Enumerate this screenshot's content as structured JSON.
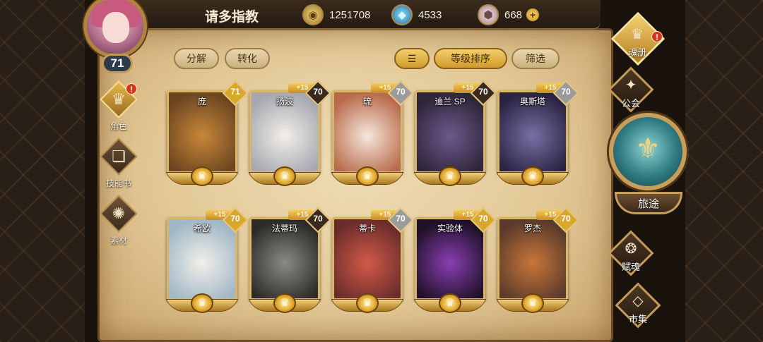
{
  "player": {
    "name": "请多指教",
    "level": "71"
  },
  "currencies": [
    {
      "icon": "gold-coin-icon",
      "value": "1251708"
    },
    {
      "icon": "blue-crystal-icon",
      "value": "4533"
    },
    {
      "icon": "pink-stone-icon",
      "value": "668"
    }
  ],
  "toolbar": {
    "decompose": "分解",
    "convert": "转化",
    "sort_level": "等级排序",
    "filter": "筛选"
  },
  "left_nav": [
    {
      "label": "角色",
      "icon": "character-icon",
      "alert": "!"
    },
    {
      "label": "技能书",
      "icon": "skill-book-icon"
    },
    {
      "label": "素材",
      "icon": "material-icon"
    }
  ],
  "right_nav": {
    "soul_book": {
      "label": "魂册",
      "alert": "!"
    },
    "guild": "公会",
    "journey": "旅途",
    "soul_gift": "赋魂",
    "market": "市集"
  },
  "heroes": [
    {
      "name": "庞",
      "level": "71",
      "plus": "",
      "rarity_color": "#d9a72c",
      "art": [
        "#c8873a",
        "#6b4520"
      ]
    },
    {
      "name": "扬波",
      "level": "70",
      "plus": "+15",
      "rarity_color": "#3a2a1e",
      "art": [
        "#f3efe8",
        "#a6a7b0"
      ]
    },
    {
      "name": "琉",
      "level": "70",
      "plus": "+15",
      "rarity_color": "#9b9b9b",
      "art": [
        "#f6e7dc",
        "#b86a4a"
      ]
    },
    {
      "name": "迪兰 SP",
      "level": "70",
      "plus": "+15",
      "rarity_color": "#3a2a1e",
      "art": [
        "#6b5a8c",
        "#2e2538"
      ]
    },
    {
      "name": "奥斯塔",
      "level": "70",
      "plus": "+15",
      "rarity_color": "#9b9b9b",
      "art": [
        "#7a6fa6",
        "#2a2340"
      ]
    },
    {
      "name": "希欧",
      "level": "70",
      "plus": "+15",
      "rarity_color": "#d9a72c",
      "art": [
        "#f2efe9",
        "#9fb7c6"
      ]
    },
    {
      "name": "法蒂玛",
      "level": "70",
      "plus": "+15",
      "rarity_color": "#3a2a1e",
      "art": [
        "#8a8a86",
        "#2c2a28"
      ]
    },
    {
      "name": "蒂卡",
      "level": "70",
      "plus": "+15",
      "rarity_color": "#9b9b9b",
      "art": [
        "#d25a4a",
        "#6a2c2a"
      ]
    },
    {
      "name": "实验体",
      "level": "70",
      "plus": "+15",
      "rarity_color": "#d9a72c",
      "art": [
        "#8a3fb3",
        "#1e1026"
      ]
    },
    {
      "name": "罗杰",
      "level": "70",
      "plus": "+15",
      "rarity_color": "#d9a72c",
      "art": [
        "#c8763a",
        "#5a3a2a"
      ]
    }
  ]
}
